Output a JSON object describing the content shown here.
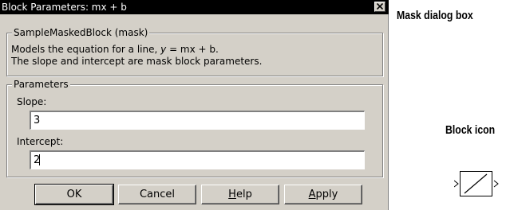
{
  "dialog": {
    "title": "Block Parameters: mx + b",
    "description_group": {
      "legend": "SampleMaskedBlock (mask)",
      "line1_pre": "Models the equation for a line, ",
      "line1_eq_var": "y",
      "line1_eq_rest": " = mx + b.",
      "line2": "The slope and intercept are mask block parameters."
    },
    "parameters_group": {
      "legend": "Parameters",
      "slope_label": "Slope:",
      "slope_value": "3",
      "intercept_label": "Intercept:",
      "intercept_value": "2"
    },
    "buttons": {
      "ok": "OK",
      "cancel": "Cancel",
      "help_mnemonic": "H",
      "help_rest": "elp",
      "apply_mnemonic": "A",
      "apply_rest": "pply"
    }
  },
  "annotations": {
    "mask_dialog": "Mask dialog box",
    "block_icon": "Block icon"
  },
  "icons": {
    "close": "close-icon",
    "block": "line-block-icon"
  },
  "colors": {
    "dialog_bg": "#d4d0c8",
    "titlebar_bg": "#000000",
    "titlebar_text": "#ffffff"
  }
}
